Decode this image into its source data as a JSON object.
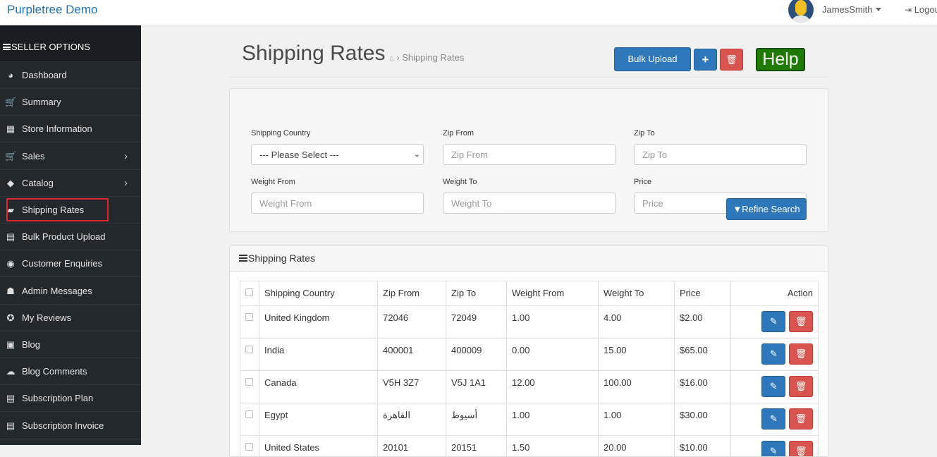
{
  "header": {
    "brand": "Purpletree Demo",
    "username": "JamesSmith",
    "logout": "Logout"
  },
  "sidebar": {
    "heading": "SELLER OPTIONS",
    "items": [
      {
        "label": "Dashboard",
        "icon": "dashboard-icon",
        "glyph": "◕"
      },
      {
        "label": "Summary",
        "icon": "cart-icon",
        "glyph": "🛒"
      },
      {
        "label": "Store Information",
        "icon": "store-icon",
        "glyph": "▦"
      },
      {
        "label": "Sales",
        "icon": "cart-icon",
        "glyph": "🛒"
      },
      {
        "label": "Catalog",
        "icon": "tags-icon",
        "glyph": "◆"
      },
      {
        "label": "Shipping Rates",
        "icon": "truck-icon",
        "glyph": "▰"
      },
      {
        "label": "Bulk Product Upload",
        "icon": "file-upload-icon",
        "glyph": "▤"
      },
      {
        "label": "Customer Enquiries",
        "icon": "enquiry-icon",
        "glyph": "◉"
      },
      {
        "label": "Admin Messages",
        "icon": "user-message-icon",
        "glyph": "☗"
      },
      {
        "label": "My Reviews",
        "icon": "review-icon",
        "glyph": "✪"
      },
      {
        "label": "Blog",
        "icon": "blog-icon",
        "glyph": "▣"
      },
      {
        "label": "Blog Comments",
        "icon": "comments-icon",
        "glyph": "☁"
      },
      {
        "label": "Subscription Plan",
        "icon": "plan-icon",
        "glyph": "▤"
      },
      {
        "label": "Subscription Invoice",
        "icon": "invoice-icon",
        "glyph": "▤"
      }
    ],
    "active": "Shipping Rates"
  },
  "page": {
    "title": "Shipping Rates",
    "breadcrumb": "Shipping Rates",
    "bulk_upload": "Bulk Upload",
    "help": "Help"
  },
  "filters": {
    "shipping_country": {
      "label": "Shipping Country",
      "value": "--- Please Select ---"
    },
    "zip_from": {
      "label": "Zip From",
      "placeholder": "Zip From"
    },
    "zip_to": {
      "label": "Zip To",
      "placeholder": "Zip To"
    },
    "weight_from": {
      "label": "Weight From",
      "placeholder": "Weight From"
    },
    "weight_to": {
      "label": "Weight To",
      "placeholder": "Weight To"
    },
    "price": {
      "label": "Price",
      "placeholder": "Price"
    },
    "refine": "Refine Search"
  },
  "list": {
    "heading": "Shipping Rates",
    "columns": [
      "Shipping Country",
      "Zip From",
      "Zip To",
      "Weight From",
      "Weight To",
      "Price",
      "Action"
    ],
    "rows": [
      [
        "United Kingdom",
        "72046",
        "72049",
        "1.00",
        "4.00",
        "$2.00"
      ],
      [
        "India",
        "400001",
        "400009",
        "0.00",
        "15.00",
        "$65.00"
      ],
      [
        "Canada",
        "V5H 3Z7",
        "V5J 1A1",
        "12.00",
        "100.00",
        "$16.00"
      ],
      [
        "Egypt",
        "القاهرة",
        "أسيوط",
        "1.00",
        "1.00",
        "$30.00"
      ],
      [
        "United States",
        "20101",
        "20151",
        "1.50",
        "20.00",
        "$10.00"
      ]
    ]
  },
  "colors": {
    "primary": "#2e77bb",
    "danger": "#d9534f",
    "help": "#1f7a00",
    "sidebar": "#23282d",
    "highlight": "#e0242c"
  }
}
